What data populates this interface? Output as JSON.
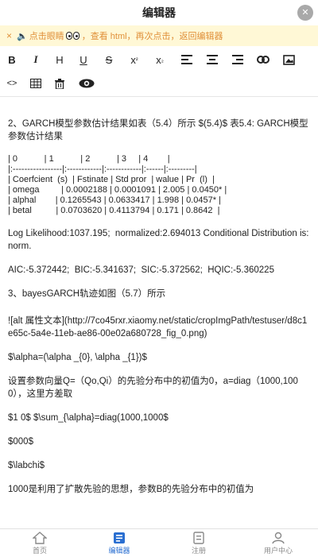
{
  "header": {
    "title": "编辑器",
    "close_label": "✕"
  },
  "hint": {
    "close": "×",
    "speaker": "🔈",
    "before_eyes": "点击眼睛",
    "after_eyes": "，查看 html，再次点击，返回编辑器"
  },
  "toolbar": {
    "bold": "B",
    "italic": "I",
    "heading": "H",
    "underline": "U",
    "strike": "S",
    "sup_base": "x",
    "sup_mark": "²",
    "sub_base": "x",
    "sub_mark": "₂",
    "code": "<>"
  },
  "content": {
    "p1": "2、GARCH模型参数估计结果如表（5.4）所示 $(5.4)$ 表5.4: GARCH模型参数估计结果",
    "table_lines": [
      "| 0           | 1           | 2           | 3     | 4        |",
      "|:-----------------|:------------|:------------|:------|:---------|",
      "| Coerfcient  (s)  | Fstinate | Std pror  | walue | Pr  (l)  |",
      "| omega         | 0.0002188 | 0.0001091 | 2.005 | 0.0450* |",
      "| alphal        | 0.1265543 | 0.0633417 | 1.998 | 0.0457* |",
      "| betal          | 0.0703620 | 0.4113794 | 0.171 | 0.8642  |"
    ],
    "p2": "Log Likelihood:1037.195;  normalized:2.694013 Conditional Distribution is:norm.",
    "p3": "AIC:-5.372442;  BIC:-5.341637;  SIC:-5.372562;  HQIC:-5.360225",
    "p4": "3、bayesGARCH轨迹如图（5.7）所示",
    "p5": "![alt 属性文本](http://7co45rxr.xiaomy.net/static/cropImgPath/testuser/d8c1e65c-5a4e-11eb-ae86-00e02a680728_fig_0.png)",
    "p6": "$\\alpha=(\\alpha _{0}, \\alpha _{1})$",
    "p7": "设置参数向量Q=（Qo,Qi）的先验分布中的初值为0，a=diag（1000,1000），这里方差取",
    "p8": "$1 0$ $\\sum_{\\alpha}=diag(1000,1000$",
    "p9": "$000$",
    "p10": "$\\labchi$",
    "p11": "1000是利用了扩散先验的思想，参数B的先验分布中的初值为"
  },
  "tabs": [
    {
      "label": "首页",
      "icon": "home-icon"
    },
    {
      "label": "编辑器",
      "icon": "editor-icon"
    },
    {
      "label": "注册",
      "icon": "register-icon"
    },
    {
      "label": "用户中心",
      "icon": "user-center-icon"
    }
  ],
  "colors": {
    "accent": "#2a6fd1",
    "hint_bg": "#fff8d6",
    "hint_text": "#e0903a"
  }
}
